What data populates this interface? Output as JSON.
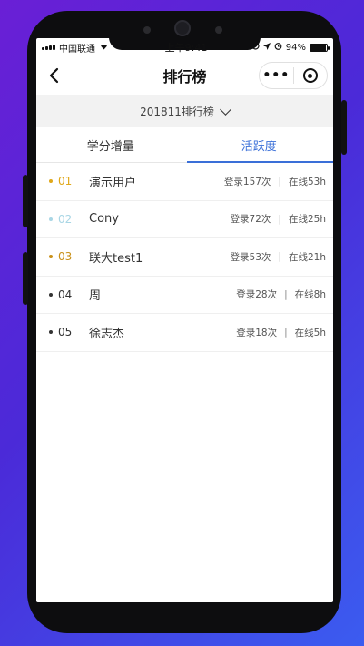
{
  "status_bar": {
    "carrier": "中国联通",
    "time": "上午9:41",
    "battery": "94%",
    "battery_level": 0.94
  },
  "navbar": {
    "title": "排行榜",
    "back_icon": "chevron-left-icon",
    "more_icon": "more-dots-icon",
    "close_icon": "target-icon",
    "more_label": "•••"
  },
  "period_selector": {
    "label": "201811排行榜",
    "icon": "chevron-down-icon"
  },
  "tabs": [
    {
      "label": "学分增量",
      "active": false
    },
    {
      "label": "活跃度",
      "active": true
    }
  ],
  "colors": {
    "accent": "#3a6fd8",
    "gold": "#e0a81a",
    "silver": "#a9d6e5",
    "bronze": "#c9911a",
    "normal": "#333333",
    "background_start": "#6a1fd6",
    "background_end": "#3b5cf0"
  },
  "rankings": [
    {
      "rank": "01",
      "name": "演示用户",
      "logins": "登录157次",
      "online": "在线53h",
      "color": "#e0a81a"
    },
    {
      "rank": "02",
      "name": "Cony",
      "logins": "登录72次",
      "online": "在线25h",
      "color": "#a9d6e5"
    },
    {
      "rank": "03",
      "name": "联大test1",
      "logins": "登录53次",
      "online": "在线21h",
      "color": "#c9911a"
    },
    {
      "rank": "04",
      "name": "周",
      "logins": "登录28次",
      "online": "在线8h",
      "color": "#333333"
    },
    {
      "rank": "05",
      "name": "徐志杰",
      "logins": "登录18次",
      "online": "在线5h",
      "color": "#333333"
    }
  ],
  "separator": "|"
}
